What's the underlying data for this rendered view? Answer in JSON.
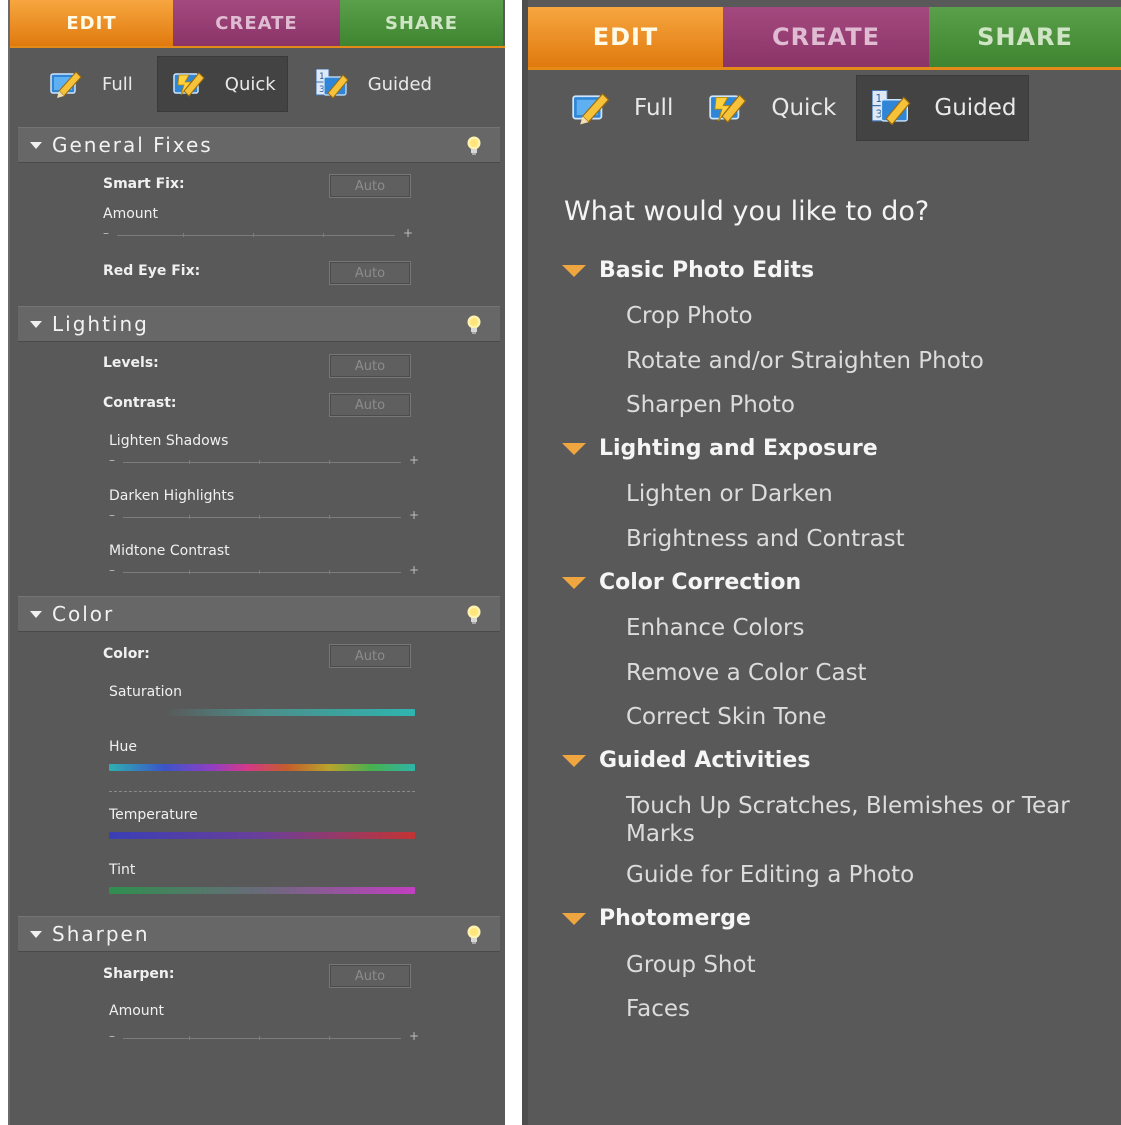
{
  "left": {
    "tabs": {
      "edit": "EDIT",
      "create": "CREATE",
      "share": "SHARE"
    },
    "modes": {
      "full": "Full",
      "quick": "Quick",
      "guided": "Guided",
      "active": "quick"
    },
    "general_fixes": {
      "title": "General Fixes",
      "smart_fix_label": "Smart Fix:",
      "smart_fix_button": "Auto",
      "amount_label": "Amount",
      "red_eye_label": "Red Eye Fix:",
      "red_eye_button": "Auto"
    },
    "lighting": {
      "title": "Lighting",
      "levels_label": "Levels:",
      "levels_button": "Auto",
      "contrast_label": "Contrast:",
      "contrast_button": "Auto",
      "lighten_shadows_label": "Lighten Shadows",
      "darken_highlights_label": "Darken Highlights",
      "midtone_contrast_label": "Midtone Contrast"
    },
    "color": {
      "title": "Color",
      "color_label": "Color:",
      "color_button": "Auto",
      "saturation_label": "Saturation",
      "hue_label": "Hue",
      "temperature_label": "Temperature",
      "tint_label": "Tint"
    },
    "sharpen": {
      "title": "Sharpen",
      "sharpen_label": "Sharpen:",
      "sharpen_button": "Auto",
      "amount_label": "Amount"
    },
    "slider_minus": "–",
    "slider_plus": "+"
  },
  "right": {
    "tabs": {
      "edit": "EDIT",
      "create": "CREATE",
      "share": "SHARE"
    },
    "modes": {
      "full": "Full",
      "quick": "Quick",
      "guided": "Guided",
      "active": "guided"
    },
    "question": "What would you like to do?",
    "categories": [
      {
        "label": "Basic Photo Edits",
        "items": [
          "Crop Photo",
          "Rotate and/or Straighten Photo",
          "Sharpen Photo"
        ]
      },
      {
        "label": "Lighting and Exposure",
        "items": [
          "Lighten or Darken",
          "Brightness and Contrast"
        ]
      },
      {
        "label": "Color Correction",
        "items": [
          "Enhance Colors",
          "Remove a Color Cast",
          "Correct Skin Tone"
        ]
      },
      {
        "label": "Guided Activities",
        "items": [
          "Touch Up Scratches, Blemishes or Tear Marks",
          "Guide for Editing a Photo"
        ]
      },
      {
        "label": "Photomerge",
        "items": [
          "Group Shot",
          "Faces"
        ]
      }
    ]
  },
  "colors": {
    "edit_tab": "#e98a1c",
    "create_tab": "#95396f",
    "share_tab": "#4a8f3b",
    "panel_bg": "#595959",
    "accent_triangle": "#f0a640"
  }
}
